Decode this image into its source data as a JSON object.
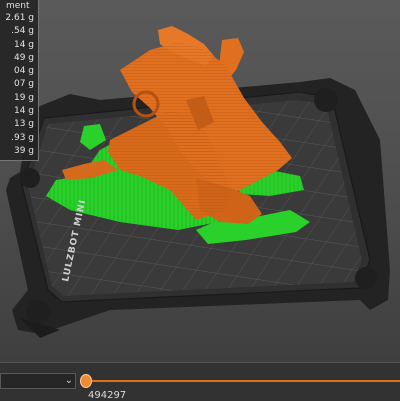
{
  "legend": {
    "header": "ment",
    "items": [
      "2.61 g",
      ".54 g",
      "14 g",
      "49 g",
      "04 g",
      "07 g",
      "19 g",
      "14 g",
      "13 g",
      ".93 g",
      "39 g"
    ]
  },
  "viewport": {
    "bed_label": "LULZBOT MINI",
    "colors": {
      "model": "#e07020",
      "support": "#22dd22",
      "bed": "#2e2e2e",
      "background": "#4e4e4e"
    }
  },
  "bottom_bar": {
    "combo_value": "",
    "combo_icon": "chevron-down-icon",
    "slider_value": "494297",
    "accent_color": "#e0701e"
  }
}
